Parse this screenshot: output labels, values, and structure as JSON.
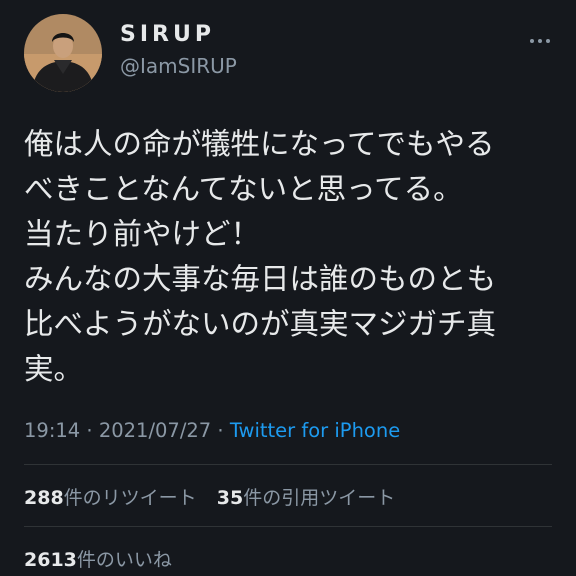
{
  "author": {
    "display_name": "SIRUP",
    "handle": "@IamSIRUP"
  },
  "more_icon": "more-horizontal-icon",
  "tweet": {
    "lines": [
      "俺は人の命が犠牲になってでもやる",
      "べきことなんてないと思ってる。",
      "当たり前やけど！",
      "みんなの大事な毎日は誰のものとも",
      "比べようがないのが真実マジガチ真",
      "実。"
    ]
  },
  "meta": {
    "time": "19:14",
    "sep1": " · ",
    "date": "2021/07/27",
    "sep2": " · ",
    "source": "Twitter for iPhone"
  },
  "stats": {
    "retweets_count": "288",
    "retweets_label": "件のリツイート",
    "quotes_count": "35",
    "quotes_label": "件の引用ツイート",
    "likes_count": "2613",
    "likes_label": "件のいいね"
  },
  "colors": {
    "background": "#15181d",
    "text": "#e7e9ea",
    "secondary": "#8b98a5",
    "link": "#1d9bf0",
    "divider": "#2f3336"
  }
}
